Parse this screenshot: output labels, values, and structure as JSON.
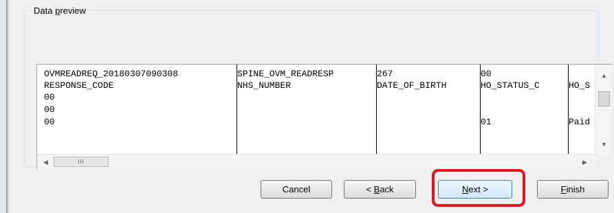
{
  "group": {
    "title_prefix": "Data ",
    "title_mnemonic": "p",
    "title_rest": "review"
  },
  "preview": {
    "rows": [
      [
        "OVMREADREQ_20180307090308",
        "SPINE_OVM_READRESP",
        "267",
        "00",
        ""
      ],
      [
        "RESPONSE_CODE",
        "NHS_NUMBER",
        "DATE_OF_BIRTH",
        "HO_STATUS_C",
        "HO_S"
      ],
      [
        "00",
        "",
        "",
        "",
        ""
      ],
      [
        "00",
        "",
        "",
        "",
        ""
      ],
      [
        "00",
        "",
        "",
        "01",
        "Paid"
      ]
    ],
    "scroll": {
      "up_arrow": "▲",
      "down_arrow": "▼",
      "left_arrow": "◀",
      "right_arrow": "▶",
      "grip": "III"
    }
  },
  "buttons": {
    "cancel": {
      "label": "Cancel"
    },
    "back": {
      "prefix": "< ",
      "mnemonic": "B",
      "rest": "ack"
    },
    "next": {
      "mnemonic": "N",
      "rest": "ext >"
    },
    "finish": {
      "mnemonic": "F",
      "rest": "inish"
    }
  },
  "annotation": {
    "highlight_color": "#e3141b",
    "highlight_target": "next-button"
  }
}
